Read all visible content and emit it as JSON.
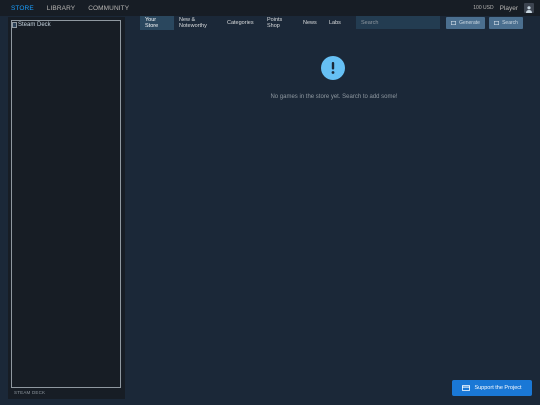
{
  "topbar": {
    "nav": [
      "STORE",
      "LIBRARY",
      "COMMUNITY"
    ],
    "active_index": 0,
    "currency": "100 USD",
    "player": "Player",
    "avatar_icon": "user-icon"
  },
  "left_panel": {
    "image_alt": "Steam Deck",
    "caption": "STEAM DECK"
  },
  "store_nav": {
    "tabs": [
      "Your Store",
      "New & Noteworthy",
      "Categories",
      "Points Shop",
      "News",
      "Labs"
    ],
    "active_index": 0,
    "search_placeholder": "Search",
    "generate_label": "Generate",
    "search_label": "Search"
  },
  "empty_state": {
    "icon": "exclamation-icon",
    "message": "No games in the store yet. Search to add some!"
  },
  "support": {
    "label": "Support the Project",
    "icon": "credit-card-icon"
  },
  "colors": {
    "background": "#1b2838",
    "topbar": "#171d25",
    "accent": "#1a9fff",
    "info": "#66c0f4",
    "support_button": "#1a78d6"
  }
}
